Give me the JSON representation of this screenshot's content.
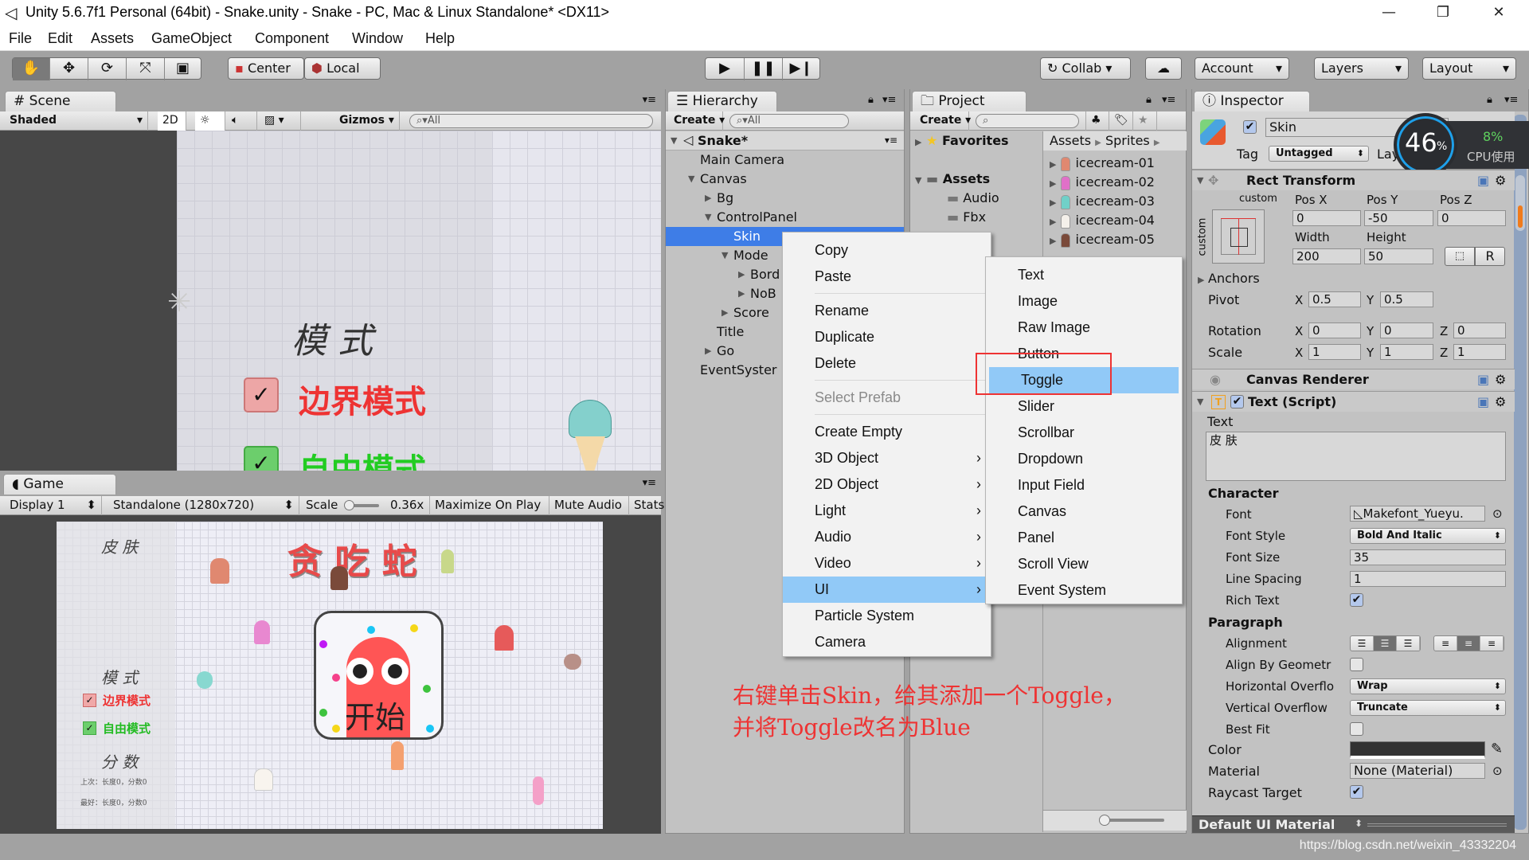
{
  "window": {
    "title": "Unity 5.6.7f1 Personal (64bit) - Snake.unity - Snake - PC, Mac & Linux Standalone* <DX11>",
    "controls": [
      "minimize-icon",
      "restore-icon",
      "close-icon"
    ]
  },
  "menubar": [
    "File",
    "Edit",
    "Assets",
    "GameObject",
    "Component",
    "Window",
    "Help"
  ],
  "toolbar": {
    "tools": [
      "hand-icon",
      "move-icon",
      "rotate-icon",
      "scale-icon",
      "rect-icon"
    ],
    "pivot": "Center",
    "space": "Local",
    "play": [
      "play-icon",
      "pause-icon",
      "step-icon"
    ],
    "collab": "Collab",
    "account": "Account",
    "layers": "Layers",
    "layout": "Layout"
  },
  "scene": {
    "tab": "Scene",
    "shading": "Shaded",
    "mode2d": "2D",
    "gizmos": "Gizmos",
    "search": "All",
    "content": {
      "heading": "模 式",
      "toggle1": "边界模式",
      "toggle2": "自由模式"
    }
  },
  "game": {
    "tab": "Game",
    "display": "Display 1",
    "resolution": "Standalone (1280x720)",
    "scale_label": "Scale",
    "scale_value": "0.36x",
    "maximize": "Maximize On Play",
    "mute": "Mute Audio",
    "stats": "Stats",
    "content": {
      "skin": "皮 肤",
      "title": "贪 吃 蛇",
      "mode": "模 式",
      "toggle1": "边界模式",
      "toggle2": "自由模式",
      "score": "分 数",
      "last": "上次：长度0，分数0",
      "best": "最好：长度0，分数0",
      "start": "开始"
    }
  },
  "hierarchy": {
    "tab": "Hierarchy",
    "create": "Create",
    "search": "All",
    "scene": "Snake*",
    "rows": [
      {
        "label": "Main Camera",
        "level": 0,
        "arrow": ""
      },
      {
        "label": "Canvas",
        "level": 0,
        "arrow": "open"
      },
      {
        "label": "Bg",
        "level": 1,
        "arrow": "closed"
      },
      {
        "label": "ControlPanel",
        "level": 1,
        "arrow": "open"
      },
      {
        "label": "Skin",
        "level": 2,
        "arrow": "",
        "selected": true
      },
      {
        "label": "Mode",
        "level": 2,
        "arrow": "open"
      },
      {
        "label": "Bord",
        "level": 3,
        "arrow": "closed"
      },
      {
        "label": "NoB",
        "level": 3,
        "arrow": "closed"
      },
      {
        "label": "Score",
        "level": 2,
        "arrow": "closed"
      },
      {
        "label": "Title",
        "level": 1,
        "arrow": ""
      },
      {
        "label": "Go",
        "level": 1,
        "arrow": "closed"
      },
      {
        "label": "EventSyster",
        "level": 0,
        "arrow": ""
      }
    ]
  },
  "project": {
    "tab": "Project",
    "create": "Create",
    "favorites": "Favorites",
    "assets": "Assets",
    "folders": [
      "Audio",
      "Fbx"
    ],
    "breadcrumb": [
      "Assets",
      "Sprites"
    ],
    "items": [
      {
        "label": "icecream-01",
        "color": "#e08870"
      },
      {
        "label": "icecream-02",
        "color": "#e070c8"
      },
      {
        "label": "icecream-03",
        "color": "#70d0c8"
      },
      {
        "label": "icecream-04",
        "color": "#f4f0ea"
      },
      {
        "label": "icecream-05",
        "color": "#7a4a3a"
      }
    ]
  },
  "context_menu": {
    "groups": [
      [
        {
          "label": "Copy"
        },
        {
          "label": "Paste"
        }
      ],
      [
        {
          "label": "Rename"
        },
        {
          "label": "Duplicate"
        },
        {
          "label": "Delete"
        }
      ],
      [
        {
          "label": "Select Prefab",
          "disabled": true
        }
      ],
      [
        {
          "label": "Create Empty"
        },
        {
          "label": "3D Object",
          "sub": true
        },
        {
          "label": "2D Object",
          "sub": true
        },
        {
          "label": "Light",
          "sub": true
        },
        {
          "label": "Audio",
          "sub": true
        },
        {
          "label": "Video",
          "sub": true
        },
        {
          "label": "UI",
          "sub": true,
          "highlighted": true
        },
        {
          "label": "Particle System"
        },
        {
          "label": "Camera"
        }
      ]
    ],
    "submenu": [
      "Text",
      "Image",
      "Raw Image",
      "Button",
      "Toggle",
      "Slider",
      "Scrollbar",
      "Dropdown",
      "Input Field",
      "Canvas",
      "Panel",
      "Scroll View",
      "Event System"
    ],
    "submenu_highlighted": "Toggle",
    "highlight_color": "#91c9f7"
  },
  "annotation": {
    "line1": "右键单击Skin，给其添加一个Toggle，",
    "line2": "并将Toggle改名为Blue",
    "color": "#ee3333"
  },
  "inspector": {
    "tab": "Inspector",
    "name": "Skin",
    "active": true,
    "tag_label": "Tag",
    "tag": "Untagged",
    "layer_label": "Lay",
    "rect_transform": {
      "title": "Rect Transform",
      "anchor_preset": "custom",
      "pos_x_label": "Pos X",
      "pos_y_label": "Pos Y",
      "pos_z_label": "Pos Z",
      "pos_x": "0",
      "pos_y": "-50",
      "pos_z": "0",
      "width_label": "Width",
      "height_label": "Height",
      "width": "200",
      "height": "50",
      "r_button": "R",
      "anchors": "Anchors",
      "pivot_label": "Pivot",
      "pivot_x": "0.5",
      "pivot_y": "0.5",
      "rotation_label": "Rotation",
      "rot_x": "0",
      "rot_y": "0",
      "rot_z": "0",
      "scale_label": "Scale",
      "scale_x": "1",
      "scale_y": "1",
      "scale_z": "1",
      "x": "X",
      "y": "Y",
      "z": "Z"
    },
    "canvas_renderer": "Canvas Renderer",
    "text_script": {
      "title": "Text (Script)",
      "text_label": "Text",
      "text": "皮 肤",
      "character": "Character",
      "font_label": "Font",
      "font": "Makefont_Yueyu.",
      "font_style_label": "Font Style",
      "font_style": "Bold And Italic",
      "font_size_label": "Font Size",
      "font_size": "35",
      "line_spacing_label": "Line Spacing",
      "line_spacing": "1",
      "rich_text_label": "Rich Text",
      "rich_text": true,
      "paragraph": "Paragraph",
      "alignment_label": "Alignment",
      "align_geometry_label": "Align By Geometr",
      "align_geometry": false,
      "h_overflow_label": "Horizontal Overflo",
      "h_overflow": "Wrap",
      "v_overflow_label": "Vertical Overflow",
      "v_overflow": "Truncate",
      "best_fit_label": "Best Fit",
      "best_fit": false,
      "color_label": "Color",
      "color": "#323232",
      "material_label": "Material",
      "material": "None (Material)",
      "raycast_label": "Raycast Target",
      "raycast": true
    },
    "material_bar": "Default UI Material"
  },
  "cpu_widget": {
    "percent": "46",
    "percent_sign": "%",
    "cpu": "8%",
    "cpu_label": "CPU使用"
  },
  "watermark": "https://blog.csdn.net/weixin_43332204"
}
